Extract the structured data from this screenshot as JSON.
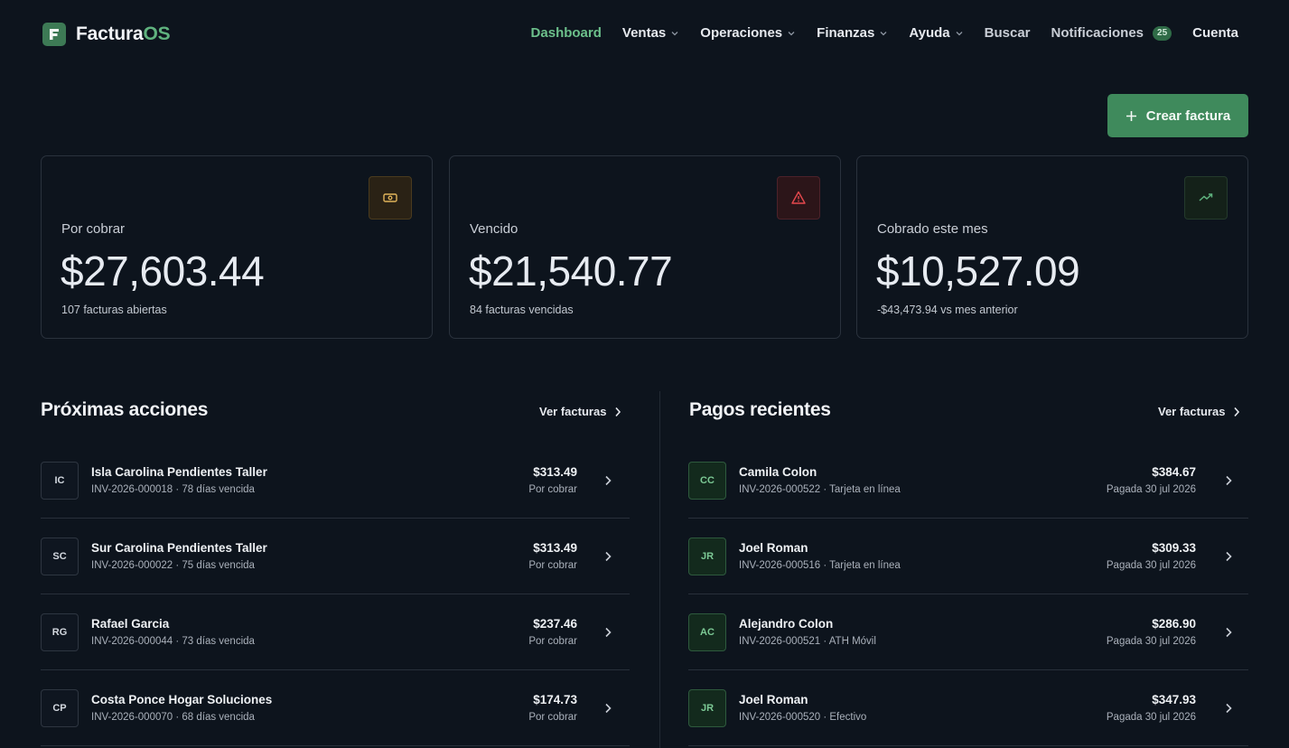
{
  "brand": {
    "name_main": "Factura",
    "name_accent": "OS"
  },
  "nav": {
    "dashboard": "Dashboard",
    "ventas": "Ventas",
    "operaciones": "Operaciones",
    "finanzas": "Finanzas",
    "ayuda": "Ayuda",
    "buscar": "Buscar",
    "notificaciones": "Notificaciones",
    "notif_count": "25",
    "cuenta": "Cuenta"
  },
  "actions": {
    "create_invoice": "Crear factura"
  },
  "stats": [
    {
      "label": "Por cobrar",
      "value": "$27,603.44",
      "sub": "107 facturas abiertas",
      "icon": "money-icon",
      "color": "#e0b35a"
    },
    {
      "label": "Vencido",
      "value": "$21,540.77",
      "sub": "84 facturas vencidas",
      "icon": "warning-icon",
      "color": "#e5484d"
    },
    {
      "label": "Cobrado este mes",
      "value": "$10,527.09",
      "sub": "-$43,473.94 vs mes anterior",
      "icon": "trending-up-icon",
      "color": "#5fb27e"
    }
  ],
  "next_actions": {
    "title": "Próximas acciones",
    "link": "Ver facturas",
    "items": [
      {
        "initials": "IC",
        "name": "Isla Carolina Pendientes Taller",
        "meta": "INV-2026-000018 · 78 días vencida",
        "amount": "$313.49",
        "status": "Por cobrar"
      },
      {
        "initials": "SC",
        "name": "Sur Carolina Pendientes Taller",
        "meta": "INV-2026-000022 · 75 días vencida",
        "amount": "$313.49",
        "status": "Por cobrar"
      },
      {
        "initials": "RG",
        "name": "Rafael Garcia",
        "meta": "INV-2026-000044 · 73 días vencida",
        "amount": "$237.46",
        "status": "Por cobrar"
      },
      {
        "initials": "CP",
        "name": "Costa Ponce Hogar Soluciones",
        "meta": "INV-2026-000070 · 68 días vencida",
        "amount": "$174.73",
        "status": "Por cobrar"
      }
    ]
  },
  "recent_payments": {
    "title": "Pagos recientes",
    "link": "Ver facturas",
    "items": [
      {
        "initials": "CC",
        "name": "Camila Colon",
        "meta": "INV-2026-000522 · Tarjeta en línea",
        "amount": "$384.67",
        "status": "Pagada 30 jul 2026"
      },
      {
        "initials": "JR",
        "name": "Joel Roman",
        "meta": "INV-2026-000516 · Tarjeta en línea",
        "amount": "$309.33",
        "status": "Pagada 30 jul 2026"
      },
      {
        "initials": "AC",
        "name": "Alejandro Colon",
        "meta": "INV-2026-000521 · ATH Móvil",
        "amount": "$286.90",
        "status": "Pagada 30 jul 2026"
      },
      {
        "initials": "JR",
        "name": "Joel Roman",
        "meta": "INV-2026-000520 · Efectivo",
        "amount": "$347.93",
        "status": "Pagada 30 jul 2026"
      }
    ]
  }
}
